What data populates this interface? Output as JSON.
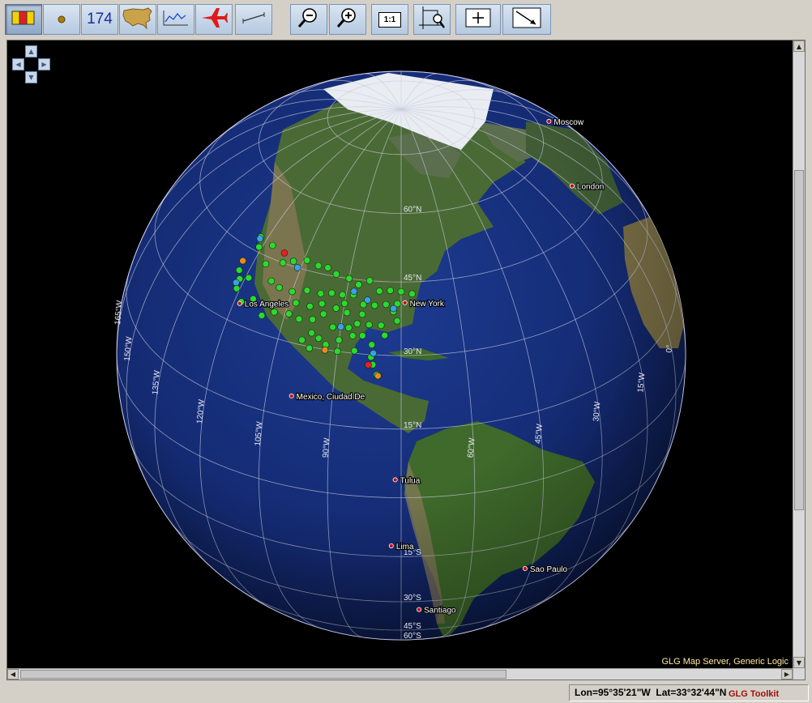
{
  "toolbar": {
    "counter": "174",
    "zoom_ratio_label": "1:1"
  },
  "map": {
    "credit": "GLG Map Server, Generic Logic",
    "cities": [
      {
        "name": "Moscow",
        "lon": 37.6,
        "lat": 55.75,
        "side": "right"
      },
      {
        "name": "London",
        "lon": -0.13,
        "lat": 51.5,
        "side": "right"
      },
      {
        "name": "New York",
        "lon": -74.0,
        "lat": 40.7,
        "side": "right"
      },
      {
        "name": "Los Angeles",
        "lon": -118.24,
        "lat": 34.05,
        "side": "right"
      },
      {
        "name": "Mexico, Ciudad De",
        "lon": -99.13,
        "lat": 19.43,
        "side": "right"
      },
      {
        "name": "Tulua",
        "lon": -76.2,
        "lat": 4.08,
        "side": "right"
      },
      {
        "name": "Lima",
        "lon": -77.03,
        "lat": -12.05,
        "side": "right"
      },
      {
        "name": "Sao Paulo",
        "lon": -46.63,
        "lat": -23.55,
        "side": "right"
      },
      {
        "name": "Santiago",
        "lon": -70.67,
        "lat": -33.45,
        "side": "right"
      }
    ],
    "meridian_labels": [
      {
        "text": "165°W",
        "lon": -165,
        "lat": 10
      },
      {
        "text": "150°W",
        "lon": -150,
        "lat": 10
      },
      {
        "text": "135°W",
        "lon": -135,
        "lat": 10
      },
      {
        "text": "120°W",
        "lon": -120,
        "lat": 10
      },
      {
        "text": "105°W",
        "lon": -105,
        "lat": 10
      },
      {
        "text": "90°W",
        "lon": -90,
        "lat": 10
      },
      {
        "text": "60°W",
        "lon": -60,
        "lat": 10
      },
      {
        "text": "45°W",
        "lon": -45,
        "lat": 10
      },
      {
        "text": "30°W",
        "lon": -30,
        "lat": 10
      },
      {
        "text": "15°W",
        "lon": -15,
        "lat": 10
      },
      {
        "text": "0°",
        "lon": 0,
        "lat": 10
      }
    ],
    "parallel_labels": [
      {
        "text": "60°N",
        "lon": -75,
        "lat": 60
      },
      {
        "text": "45°N",
        "lon": -75,
        "lat": 45
      },
      {
        "text": "30°N",
        "lon": -75,
        "lat": 30
      },
      {
        "text": "15°N",
        "lon": -75,
        "lat": 15
      },
      {
        "text": "15°S",
        "lon": -75,
        "lat": -15
      },
      {
        "text": "30°S",
        "lon": -75,
        "lat": -30
      },
      {
        "text": "45°S",
        "lon": -75,
        "lat": -45
      },
      {
        "text": "60°S",
        "lon": -75,
        "lat": -60
      }
    ],
    "markers_green": [
      [
        -122.5,
        48
      ],
      [
        -121,
        46
      ],
      [
        -117,
        47.5
      ],
      [
        -111,
        45
      ],
      [
        -108,
        46
      ],
      [
        -104,
        47
      ],
      [
        -100,
        46.5
      ],
      [
        -97,
        46.5
      ],
      [
        -94,
        45.5
      ],
      [
        -90,
        45
      ],
      [
        -87,
        44
      ],
      [
        -84,
        45
      ],
      [
        -81,
        43
      ],
      [
        -78,
        43.2
      ],
      [
        -75,
        43
      ],
      [
        -72,
        42.5
      ],
      [
        -76,
        40.5
      ],
      [
        -79,
        40.3
      ],
      [
        -82,
        40
      ],
      [
        -85,
        40
      ],
      [
        -88,
        41.8
      ],
      [
        -91,
        41.5
      ],
      [
        -94,
        41.5
      ],
      [
        -97,
        41
      ],
      [
        -101,
        41
      ],
      [
        -105,
        40
      ],
      [
        -109,
        40
      ],
      [
        -112,
        40.7
      ],
      [
        -116,
        43.5
      ],
      [
        -119,
        39.5
      ],
      [
        -121.5,
        38.5
      ],
      [
        -123,
        40
      ],
      [
        -121,
        36.5
      ],
      [
        -118,
        34.5
      ],
      [
        -115,
        36
      ],
      [
        -111,
        33.5
      ],
      [
        -108,
        35
      ],
      [
        -104,
        35.5
      ],
      [
        -101,
        35
      ],
      [
        -97.5,
        35.5
      ],
      [
        -95,
        37
      ],
      [
        -92,
        38.6
      ],
      [
        -89,
        38
      ],
      [
        -86,
        36
      ],
      [
        -83,
        36
      ],
      [
        -80,
        36
      ],
      [
        -77,
        38.9
      ],
      [
        -76,
        37
      ],
      [
        -79,
        34
      ],
      [
        -82,
        32
      ],
      [
        -84.4,
        33.7
      ],
      [
        -86.8,
        33.5
      ],
      [
        -90,
        32.3
      ],
      [
        -92,
        34.7
      ],
      [
        -95,
        32
      ],
      [
        -97,
        32.8
      ],
      [
        -99,
        31
      ],
      [
        -96.8,
        29.7
      ],
      [
        -93,
        31
      ],
      [
        -90,
        30
      ],
      [
        -86,
        30.5
      ],
      [
        -82,
        29.5
      ],
      [
        -81.5,
        28
      ],
      [
        -80.5,
        26
      ],
      [
        -88,
        35
      ],
      [
        -85,
        38
      ],
      [
        -90,
        39.8
      ],
      [
        -96,
        39
      ],
      [
        -99,
        38
      ],
      [
        -103,
        38
      ]
    ],
    "markers_blue": [
      [
        -122.4,
        47.6
      ],
      [
        -106,
        45
      ],
      [
        -88,
        42.5
      ],
      [
        -84,
        41
      ],
      [
        -77,
        39.5
      ],
      [
        -122,
        37.5
      ],
      [
        -90,
        35
      ],
      [
        -81.5,
        30.3
      ]
    ],
    "markers_red": [
      [
        -112,
        47
      ],
      [
        -82.5,
        27.9
      ]
    ],
    "markers_orange": [
      [
        -123.5,
        42
      ],
      [
        -93,
        29.9
      ],
      [
        -80.2,
        25.8
      ]
    ]
  },
  "status": {
    "coords": "Lon=95°35'21\"W  Lat=33°32'44\"N",
    "brand": "GLG Toolkit"
  }
}
